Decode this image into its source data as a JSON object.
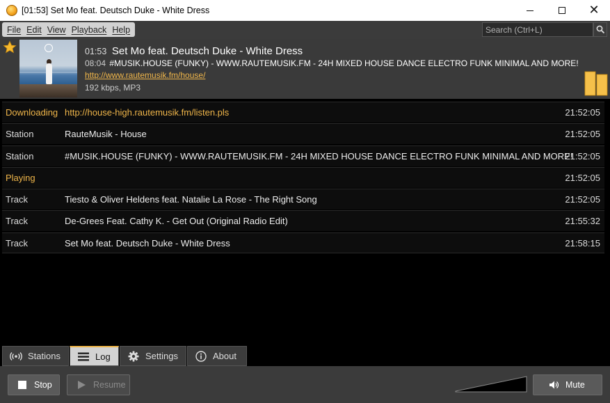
{
  "window": {
    "title": "[01:53] Set Mo feat. Deutsch Duke - White Dress",
    "minimize_label": "",
    "maximize_label": "",
    "close_label": "✕"
  },
  "menu": {
    "items": [
      "File",
      "Edit",
      "View",
      "Playback",
      "Help"
    ]
  },
  "search": {
    "placeholder": "Search (Ctrl+L)"
  },
  "now_playing": {
    "track_time": "01:53",
    "track_title": "Set Mo feat. Deutsch Duke - White Dress",
    "station_time": "08:04",
    "station_name": "#MUSIK.HOUSE (FUNKY) - WWW.RAUTEMUSIK.FM - 24H MIXED HOUSE DANCE ELECTRO FUNK MINIMAL AND MORE!",
    "url": "http://www.rautemusik.fm/house/",
    "format": "192 kbps, MP3",
    "favorite": true,
    "accent_color": "#f0b64a"
  },
  "log": {
    "rows": [
      {
        "type": "Downloading",
        "text": "http://house-high.rautemusik.fm/listen.pls",
        "time": "21:52:05",
        "highlight": true
      },
      {
        "type": "Station",
        "text": "RauteMusik - House",
        "time": "21:52:05",
        "highlight": false
      },
      {
        "type": "Station",
        "text": "#MUSIK.HOUSE (FUNKY) - WWW.RAUTEMUSIK.FM - 24H MIXED HOUSE DANCE ELECTRO FUNK MINIMAL AND MORE!",
        "time": "21:52:05",
        "highlight": false
      },
      {
        "type": "Playing",
        "text": "",
        "time": "21:52:05",
        "highlight": true
      },
      {
        "type": "Track",
        "text": "Tiesto & Oliver Heldens feat. Natalie La Rose - The Right Song",
        "time": "21:52:05",
        "highlight": false
      },
      {
        "type": "Track",
        "text": "De-Grees Feat. Cathy K. - Get Out (Original Radio Edit)",
        "time": "21:55:32",
        "highlight": false
      },
      {
        "type": "Track",
        "text": "Set Mo feat. Deutsch Duke - White Dress",
        "time": "21:58:15",
        "highlight": false
      }
    ]
  },
  "tabs": [
    {
      "label": "Stations",
      "icon": "broadcast-icon",
      "active": false
    },
    {
      "label": "Log",
      "icon": "list-icon",
      "active": true
    },
    {
      "label": "Settings",
      "icon": "gear-icon",
      "active": false
    },
    {
      "label": "About",
      "icon": "info-icon",
      "active": false
    }
  ],
  "controls": {
    "stop_label": "Stop",
    "resume_label": "Resume",
    "mute_label": "Mute",
    "resume_disabled": true
  }
}
